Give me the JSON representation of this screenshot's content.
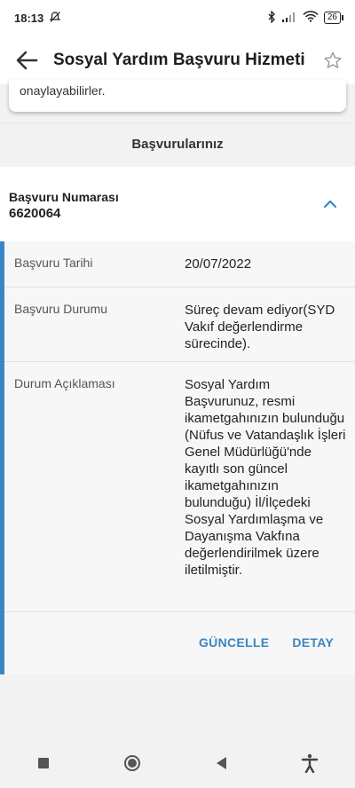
{
  "status_bar": {
    "time": "18:13",
    "battery": "26"
  },
  "header": {
    "title": "Sosyal Yardım Başvuru Hizmeti"
  },
  "notice": {
    "text": "onaylayabilirler."
  },
  "applications": {
    "section_title": "Başvurularınız",
    "number_label": "Başvuru Numarası",
    "number_value": "6620064",
    "rows": [
      {
        "label": "Başvuru Tarihi",
        "value": "20/07/2022"
      },
      {
        "label": "Başvuru Durumu",
        "value": "Süreç devam ediyor(SYD Vakıf değerlendirme sürecinde)."
      },
      {
        "label": "Durum Açıklaması",
        "value": "Sosyal Yardım Başvurunuz, resmi ikametgahınızın bulunduğu (Nüfus ve Vatandaşlık İşleri Genel Müdürlüğü'nde kayıtlı son güncel ikametgahınızın bulunduğu) İl/İlçedeki Sosyal Yardımlaşma ve Dayanışma Vakfına değerlendirilmek üzere iletilmiştir."
      }
    ],
    "actions": {
      "update": "GÜNCELLE",
      "detail": "DETAY"
    }
  },
  "colors": {
    "accent": "#3a86c4"
  }
}
